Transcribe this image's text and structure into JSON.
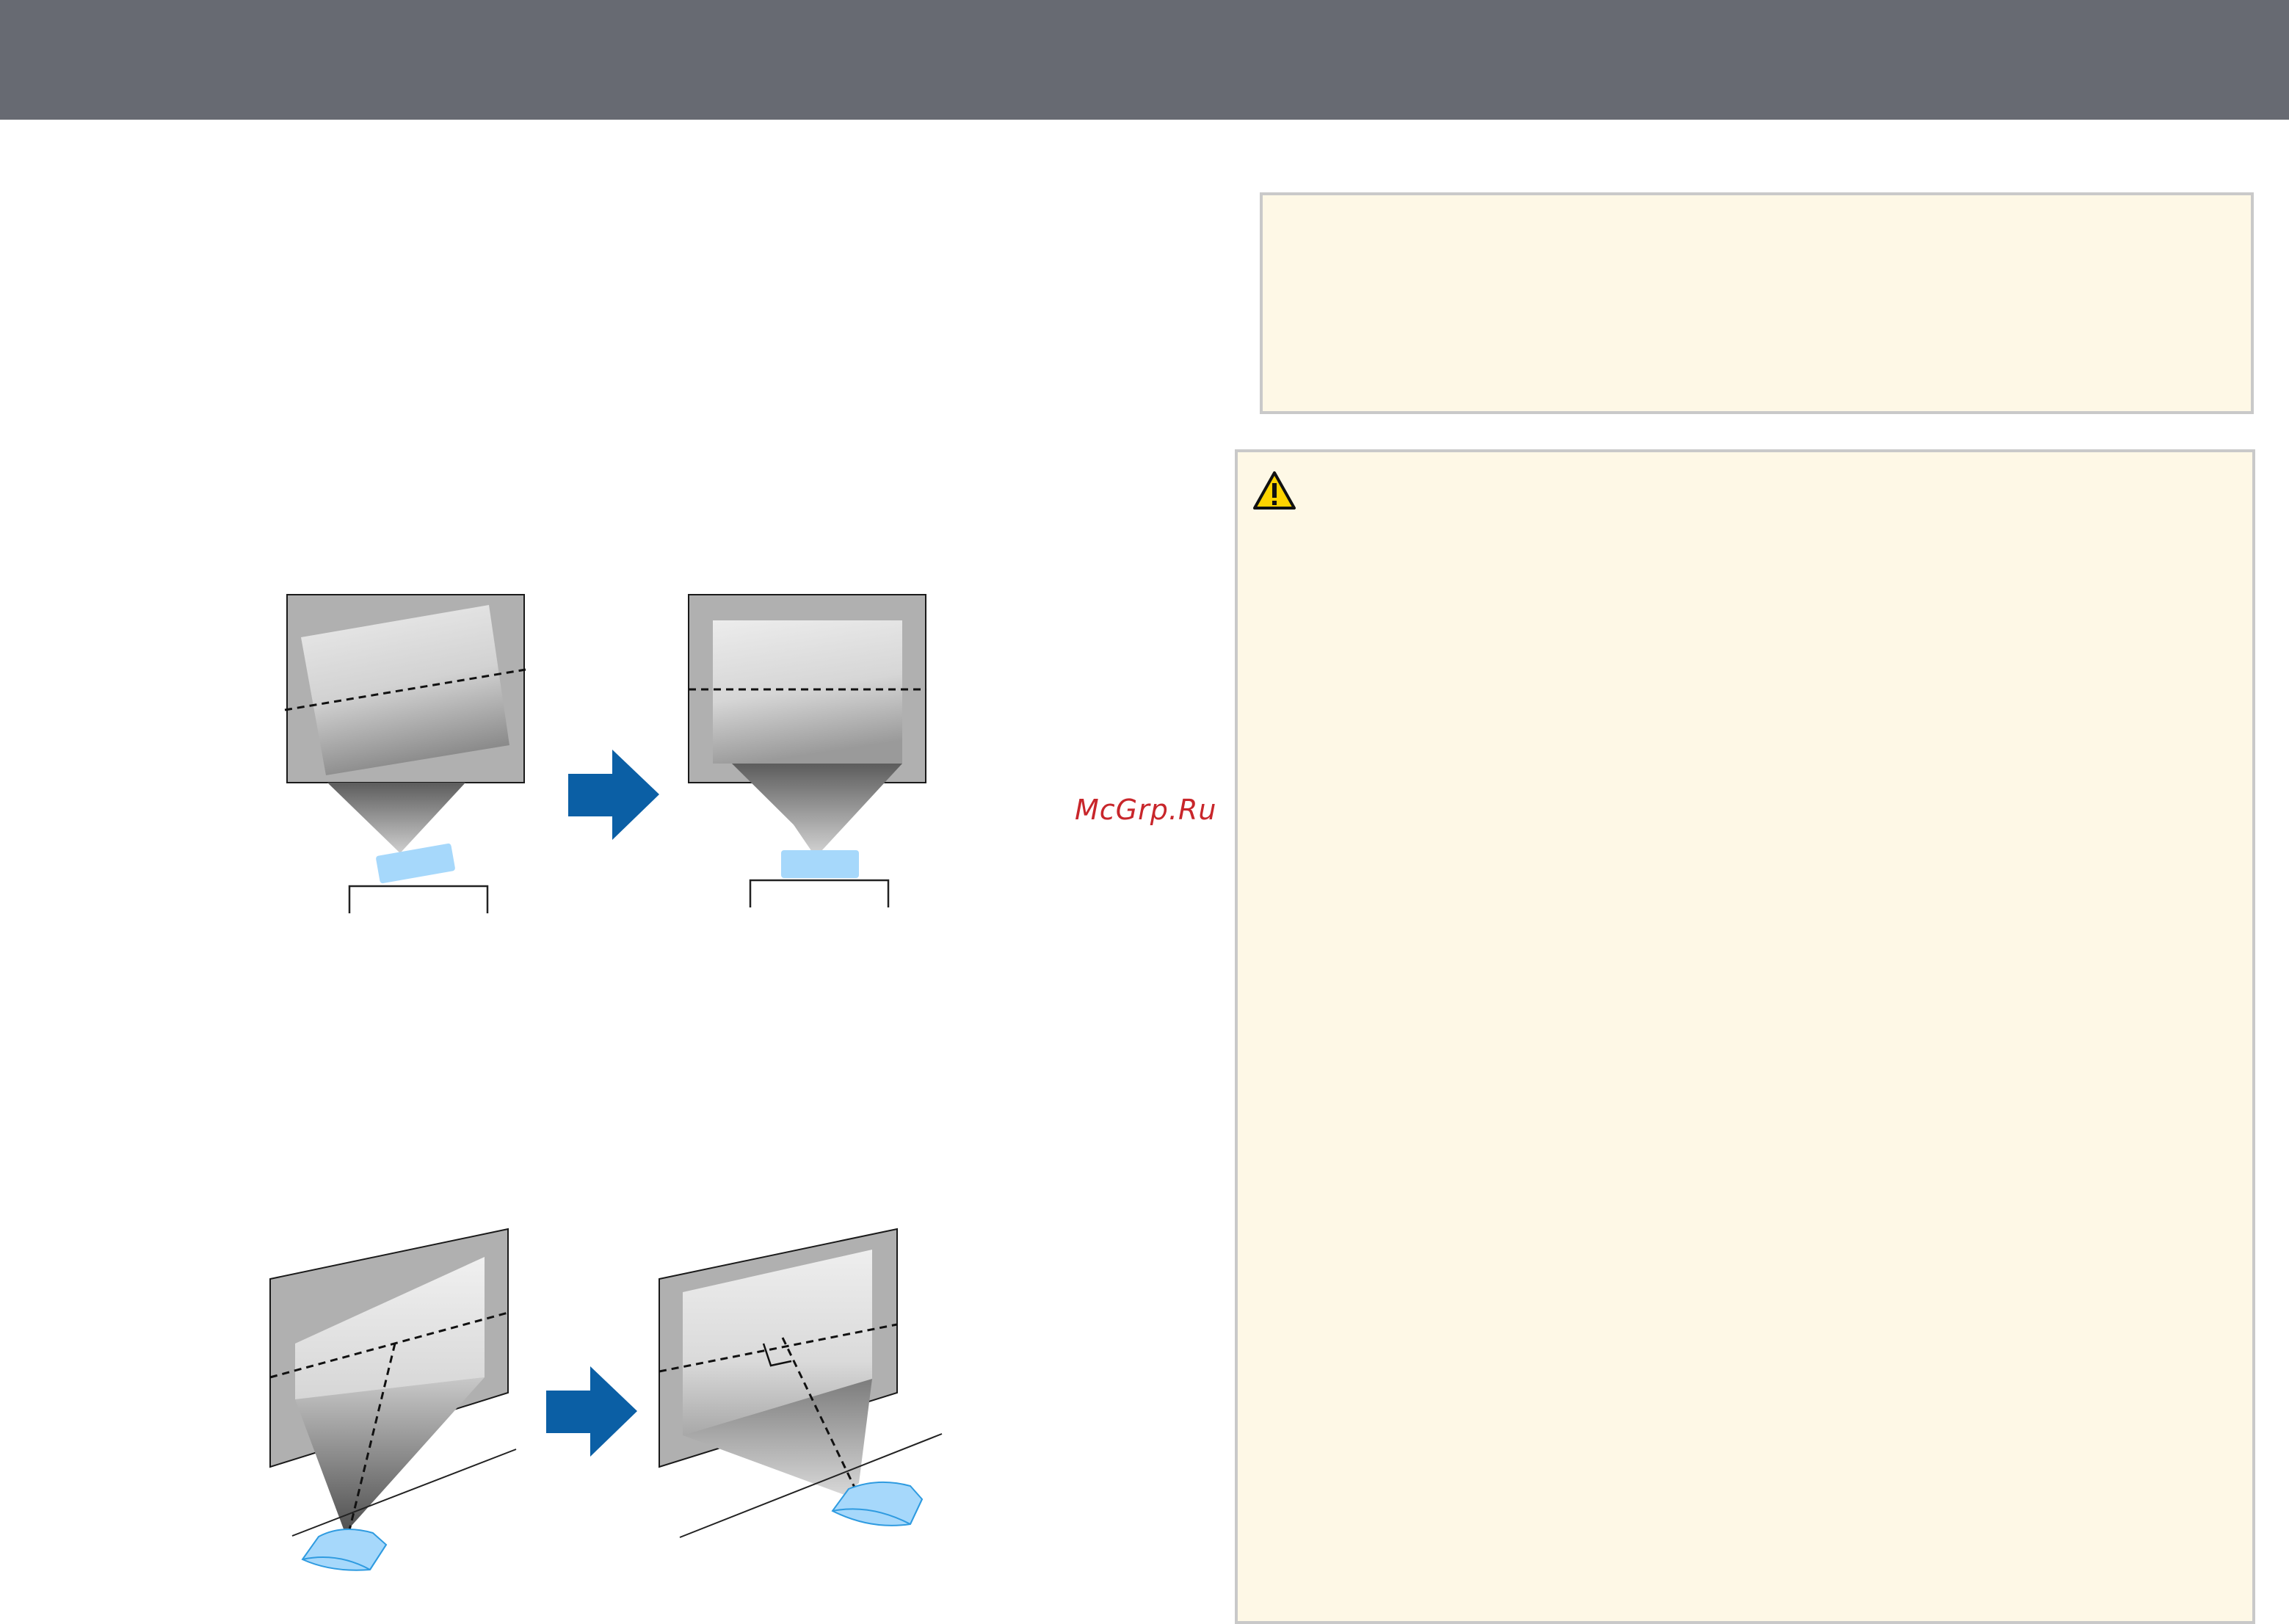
{
  "watermark": {
    "text": "McGrp.Ru"
  },
  "colors": {
    "header": "#676a72",
    "box_background": "#fef8e6",
    "box_border": "#c9c9c9",
    "arrow": "#0b5fa5",
    "projector": "#a6d8fb",
    "projector_outline": "#2f9be0",
    "watermark": "#c8262b"
  },
  "icons": {
    "caution": "warning-triangle-icon",
    "step_arrow": "right-arrow-icon"
  },
  "illustrations": {
    "front_view": {
      "before": "tilted-projector-front-view",
      "after": "level-projector-front-view"
    },
    "angle_view": {
      "before": "angled-projector-view",
      "after": "perpendicular-projector-view"
    }
  }
}
